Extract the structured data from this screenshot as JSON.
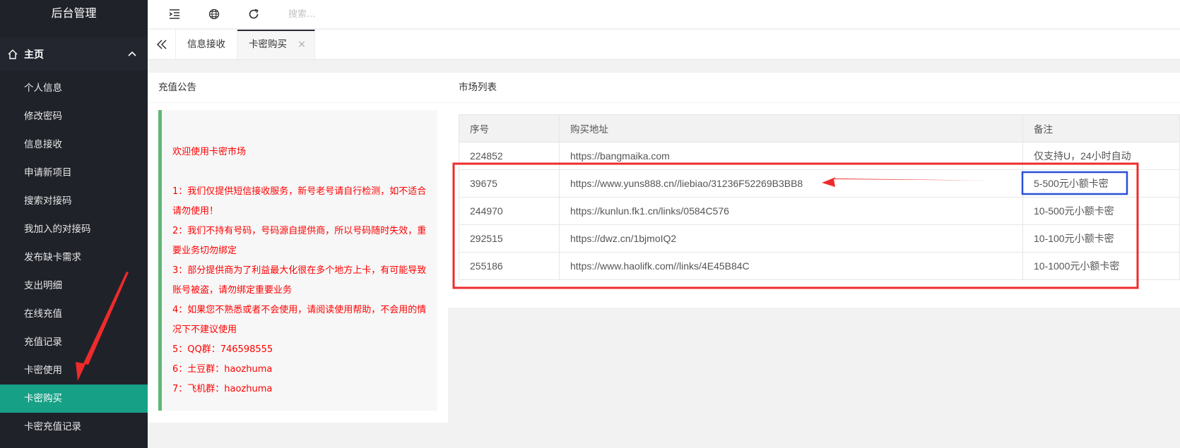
{
  "app": {
    "title": "后台管理"
  },
  "header": {
    "search_placeholder": "搜索..."
  },
  "sidebar": {
    "group_label": "主页",
    "items": [
      {
        "label": "个人信息"
      },
      {
        "label": "修改密码"
      },
      {
        "label": "信息接收"
      },
      {
        "label": "申请新项目"
      },
      {
        "label": "搜索对接码"
      },
      {
        "label": "我加入的对接码"
      },
      {
        "label": "发布缺卡需求"
      },
      {
        "label": "支出明细"
      },
      {
        "label": "在线充值"
      },
      {
        "label": "充值记录"
      },
      {
        "label": "卡密使用"
      },
      {
        "label": "卡密购买",
        "active": true
      },
      {
        "label": "卡密充值记录"
      }
    ]
  },
  "tabs": [
    {
      "label": "信息接收"
    },
    {
      "label": "卡密购买",
      "active": true,
      "close": "×"
    }
  ],
  "notice": {
    "title": "充值公告",
    "lines": [
      "欢迎使用卡密市场",
      "",
      "1：我们仅提供短信接收服务，新号老号请自行检测，如不适合请勿使用！",
      "2：我们不持有号码，号码源自提供商，所以号码随时失效，重要业务切勿绑定",
      "3：部分提供商为了利益最大化很在多个地方上卡，有可能导致账号被盗，请勿绑定重要业务",
      "4：如果您不熟悉或者不会使用，请阅读使用帮助，不会用的情况下不建议使用",
      "5：QQ群：746598555",
      "6：土豆群：haozhuma",
      "7：飞机群：haozhuma"
    ]
  },
  "market": {
    "title": "市场列表",
    "columns": [
      "序号",
      "购买地址",
      "备注"
    ],
    "rows": [
      [
        "224852",
        "https://bangmaika.com",
        "仅支持U，24小时自动"
      ],
      [
        "39675",
        "https://www.yuns888.cn//liebiao/31236F52269B3BB8",
        "5-500元小额卡密"
      ],
      [
        "244970",
        "https://kunlun.fk1.cn/links/0584C576",
        "10-500元小额卡密"
      ],
      [
        "292515",
        "https://dwz.cn/1bjmoIQ2",
        "10-100元小额卡密"
      ],
      [
        "255186",
        "https://www.haolifk.com//links/4E45B84C",
        "10-1000元小额卡密"
      ]
    ]
  },
  "colors": {
    "sidebar_bg": "#20222a",
    "sidebar_active": "#16a086",
    "notice_border": "#5fb878",
    "notice_text": "#ff0000",
    "annotation_red": "#ee2b2b",
    "annotation_blue": "#2a4fd6"
  },
  "icons": [
    "home-icon",
    "chevron-up-icon",
    "menu-fold-icon",
    "globe-icon",
    "refresh-icon",
    "double-chevron-left-icon",
    "close-icon"
  ]
}
